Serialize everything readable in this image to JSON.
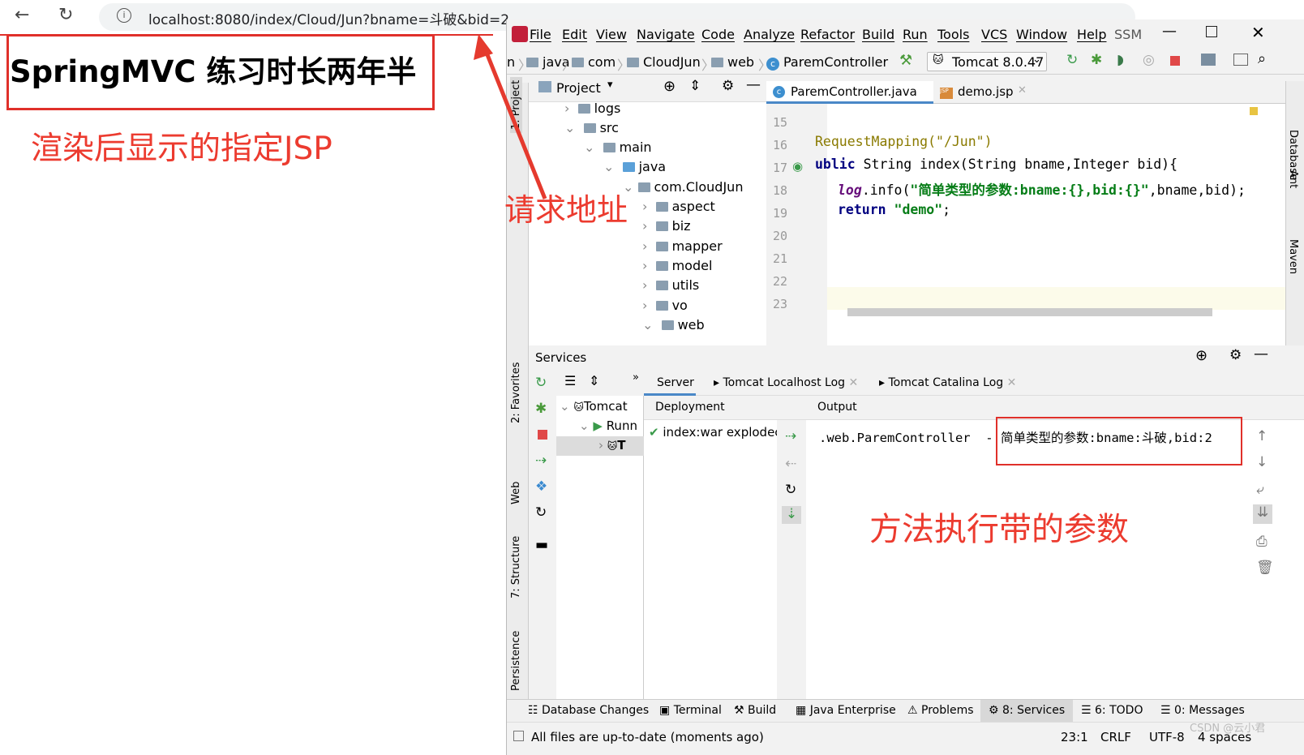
{
  "browser": {
    "url": "localhost:8080/index/Cloud/Jun?bname=斗破&bid=2",
    "page_title": "SpringMVC 练习时长两年半"
  },
  "annotations": {
    "rendered_jsp": "渲染后显示的指定JSP",
    "request_url": "请求地址",
    "method_params": "方法执行带的参数"
  },
  "ide": {
    "menu": [
      "File",
      "Edit",
      "View",
      "Navigate",
      "Code",
      "Analyze",
      "Refactor",
      "Build",
      "Run",
      "Tools",
      "VCS",
      "Window",
      "Help",
      "SSM"
    ],
    "breadcrumb": [
      "n",
      "java",
      "com",
      "CloudJun",
      "web",
      "ParemController"
    ],
    "run_config": "Tomcat 8.0.47",
    "project_label": "Project",
    "tree": [
      "logs",
      "src",
      "main",
      "java",
      "com.CloudJun",
      "aspect",
      "biz",
      "mapper",
      "model",
      "utils",
      "vo",
      "web"
    ],
    "editor_tabs": [
      "ParemController.java",
      "demo.jsp"
    ],
    "line_numbers": [
      "15",
      "16",
      "17",
      "18",
      "19",
      "20",
      "21",
      "22",
      "23"
    ],
    "code": {
      "l16": "RequestMapping(\"/Jun\")",
      "l17a": "ublic",
      "l17b": " String index(String bname,Integer bid){",
      "l18a": "log",
      "l18b": ".info(",
      "l18c": "\"简单类型的参数:bname:{},bid:{}\"",
      "l18d": ",bname,bid);",
      "l19a": "return ",
      "l19b": "\"demo\"",
      "l19c": ";"
    },
    "left_tools": [
      "1: Project",
      "2: Favorites",
      "Web",
      "7: Structure",
      "Persistence"
    ],
    "right_tools": [
      "Database",
      "Ant",
      "Maven"
    ],
    "services": {
      "title": "Services",
      "tabs": [
        "Server",
        "Tomcat Localhost Log",
        "Tomcat Catalina Log"
      ],
      "tree": [
        "Tomcat",
        "Runn",
        "T"
      ],
      "deployment_label": "Deployment",
      "deployment_item": "index:war explodec",
      "output_label": "Output",
      "output_prefix": ".web.ParemController  - ",
      "output_text": "简单类型的参数:bname:斗破,bid:2"
    },
    "bottom_tabs": [
      "Database Changes",
      "Terminal",
      "Build",
      "Java Enterprise",
      "Problems",
      "8: Services",
      "6: TODO",
      "0: Messages"
    ],
    "status": {
      "message": "All files are up-to-date (moments ago)",
      "position": "23:1",
      "line_sep": "CRLF",
      "encoding": "UTF-8",
      "indent": "4 spaces"
    },
    "watermark": "CSDN @云小君"
  }
}
